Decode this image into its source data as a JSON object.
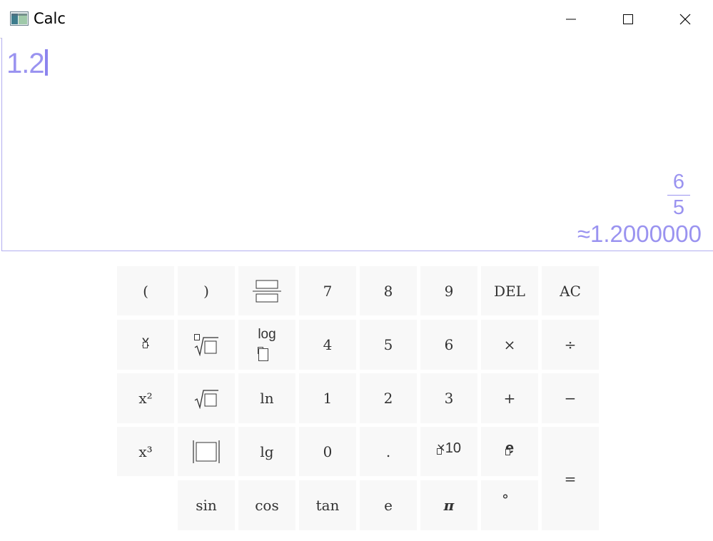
{
  "window": {
    "title": "Calc",
    "minimize": "minimize-icon",
    "maximize": "maximize-icon",
    "close": "close-icon"
  },
  "display": {
    "expression": "1.2",
    "result_fraction": {
      "numerator": "6",
      "denominator": "5"
    },
    "approximation": "≈1.2000000"
  },
  "keys": {
    "lparen": "(",
    "rparen": ")",
    "seven": "7",
    "eight": "8",
    "nine": "9",
    "del": "DEL",
    "ac": "AC",
    "four": "4",
    "five": "5",
    "six": "6",
    "times": "×",
    "divide": "÷",
    "x_squared": "x²",
    "ln": "ln",
    "one": "1",
    "two": "2",
    "three": "3",
    "plus": "+",
    "minus": "−",
    "x_cubed": "x³",
    "lg": "lg",
    "zero": "0",
    "dot": ".",
    "equals": "=",
    "sin": "sin",
    "cos": "cos",
    "tan": "tan",
    "e_const": "e",
    "pi": "π",
    "degree": "°",
    "x_power_base": "x",
    "log_label": "log",
    "e_power_base": "e",
    "times_ten": "×10"
  },
  "colors": {
    "accent": "#9a93f0",
    "key_bg": "#f8f8f8"
  }
}
